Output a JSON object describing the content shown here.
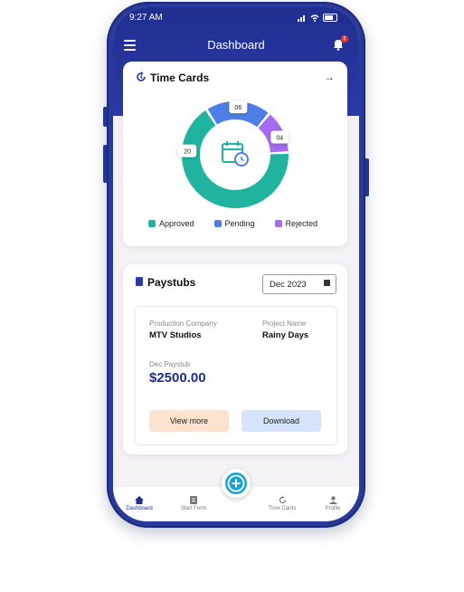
{
  "status_bar": {
    "time": "9:27 AM"
  },
  "header": {
    "title": "Dashboard",
    "notification_count": "2"
  },
  "time_cards": {
    "title": "Time Cards",
    "approved": 20,
    "pending": 6,
    "rejected": 4,
    "labels": {
      "approved": "20",
      "pending": "06",
      "rejected": "04"
    },
    "legend": {
      "approved": "Approved",
      "pending": "Pending",
      "rejected": "Rejected"
    },
    "colors": {
      "approved": "#1fb3a0",
      "pending": "#4f7fe6",
      "rejected": "#a56bf0"
    }
  },
  "paystubs": {
    "title": "Paystubs",
    "selected_month": "Dec 2023",
    "production_company_label": "Production Company",
    "production_company": "MTV Studios",
    "project_name_label": "Project Name",
    "project_name": "Rainy Days",
    "paystub_label": "Dec Paystub",
    "amount": "$2500.00",
    "view_more_label": "View more",
    "download_label": "Download"
  },
  "tabbar": {
    "dashboard": "Dashboard",
    "start_form": "Start Form",
    "time_cards": "Time Cards",
    "profile": "Profile"
  }
}
